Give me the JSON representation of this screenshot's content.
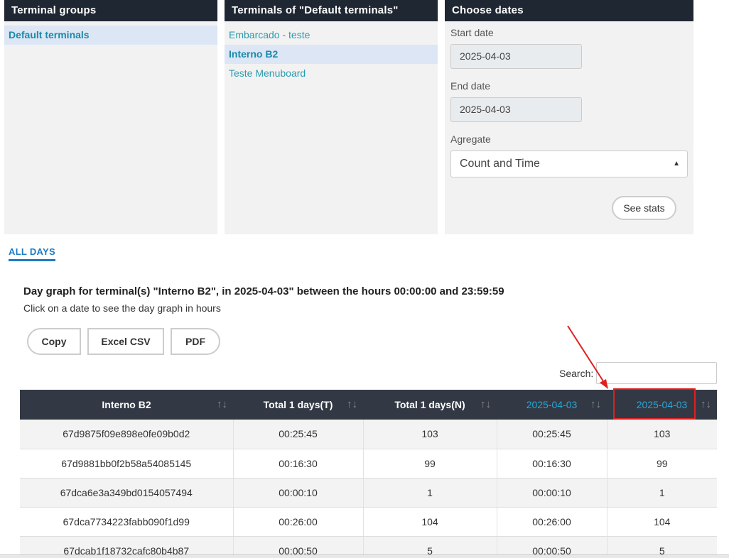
{
  "terminal_groups": {
    "title": "Terminal groups",
    "items": [
      {
        "label": "Default terminals",
        "selected": true
      }
    ]
  },
  "terminals": {
    "title": "Terminals of \"Default terminals\"",
    "items": [
      {
        "label": "Embarcado - teste",
        "selected": false
      },
      {
        "label": "Interno B2",
        "selected": true
      },
      {
        "label": "Teste Menuboard",
        "selected": false
      }
    ]
  },
  "dates": {
    "title": "Choose dates",
    "start_label": "Start date",
    "start_value": "2025-04-03",
    "end_label": "End date",
    "end_value": "2025-04-03",
    "aggregate_label": "Agregate",
    "aggregate_value": "Count and Time",
    "see_stats_label": "See stats"
  },
  "tabs": {
    "all_days": "ALL DAYS"
  },
  "graph": {
    "title": "Day graph for terminal(s) \"Interno B2\", in 2025-04-03\" between the hours 00:00:00 and 23:59:59",
    "subtitle": "Click on a date to see the day graph in hours"
  },
  "export": {
    "copy": "Copy",
    "excel": "Excel CSV",
    "pdf": "PDF"
  },
  "search": {
    "label": "Search:",
    "value": ""
  },
  "table": {
    "headers": [
      "Interno B2",
      "Total 1 days(T)",
      "Total 1 days(N)",
      "2025-04-03",
      "2025-04-03"
    ],
    "rows": [
      [
        "67d9875f09e898e0fe09b0d2",
        "00:25:45",
        "103",
        "00:25:45",
        "103"
      ],
      [
        "67d9881bb0f2b58a54085145",
        "00:16:30",
        "99",
        "00:16:30",
        "99"
      ],
      [
        "67dca6e3a349bd0154057494",
        "00:00:10",
        "1",
        "00:00:10",
        "1"
      ],
      [
        "67dca7734223fabb090f1d99",
        "00:26:00",
        "104",
        "00:26:00",
        "104"
      ],
      [
        "67dcab1f18732cafc80b4b87",
        "00:00:50",
        "5",
        "00:00:50",
        "5"
      ]
    ]
  },
  "colors": {
    "header_bg": "#1f2733",
    "link": "#2a9bb0",
    "date_header": "#2aa6d5",
    "annotation": "#e02020"
  }
}
